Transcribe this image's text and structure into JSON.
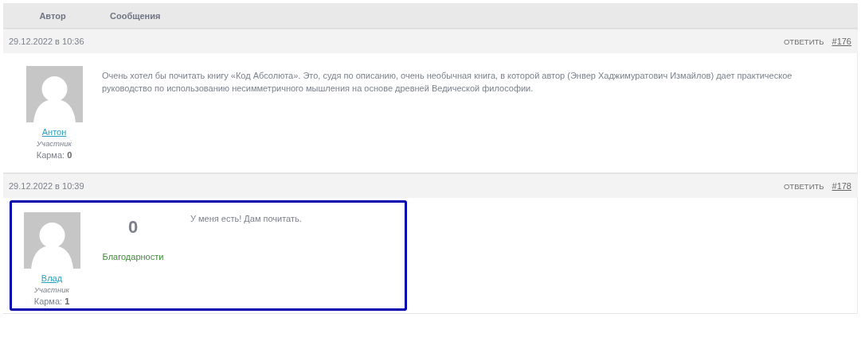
{
  "header": {
    "columns": [
      "Автор",
      "Сообщения"
    ]
  },
  "posts": [
    {
      "date": "29.12.2022 в 10:36",
      "reply": "ОТВЕТИТЬ",
      "number": "#176",
      "author": {
        "name": "Антон",
        "role": "Участник",
        "karma_label": "Карма:",
        "karma": "0"
      },
      "message": "Очень хотел бы почитать книгу «Код Абсолюта». Это, судя по описанию, очень необычная книга, в которой автор (Энвер Хаджимуратович Измайлов) дает практическое руководство по использованию несимметричного мышления на основе древней Ведической философии.",
      "highlighted": false
    },
    {
      "date": "29.12.2022 в 10:39",
      "reply": "ОТВЕТИТЬ",
      "number": "#178",
      "author": {
        "name": "Влад",
        "role": "Участник",
        "karma_label": "Карма:",
        "karma": "1"
      },
      "thanks": {
        "count": "0",
        "label": "Благодарности"
      },
      "message": "У меня есть! Дам почитать.",
      "highlighted": true
    }
  ]
}
